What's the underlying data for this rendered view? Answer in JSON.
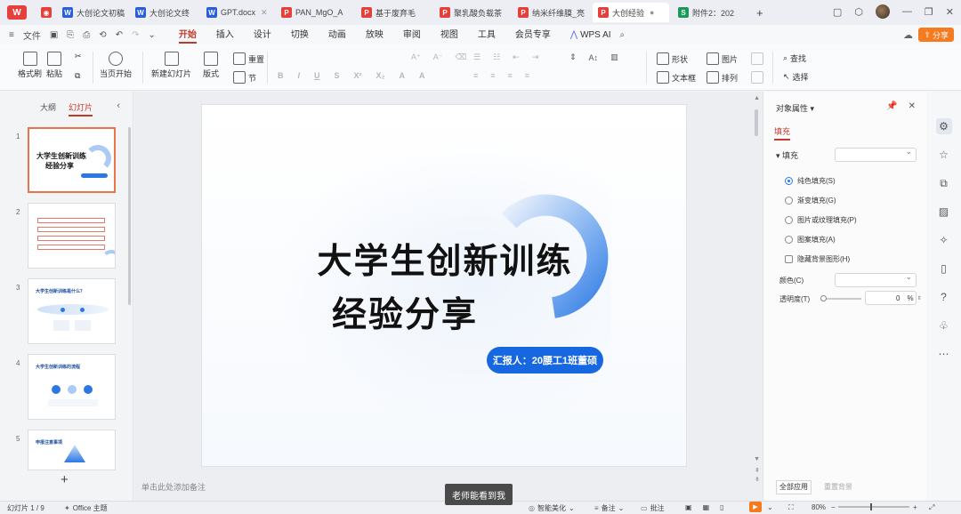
{
  "tabs": [
    {
      "label": "大创论文初稿",
      "icon": "W",
      "color": "#2b5fd9"
    },
    {
      "label": "大创论文终",
      "icon": "W",
      "color": "#2b5fd9"
    },
    {
      "label": "GPT.docx",
      "icon": "W",
      "color": "#2b5fd9"
    },
    {
      "label": "PAN_MgO_A",
      "icon": "P",
      "color": "#e5403b"
    },
    {
      "label": "基于废弃毛",
      "icon": "P",
      "color": "#e5403b"
    },
    {
      "label": "聚乳酸负载茶",
      "icon": "P",
      "color": "#e5403b"
    },
    {
      "label": "纳米纤维膜_亮",
      "icon": "P",
      "color": "#e5403b"
    },
    {
      "label": "大创经验",
      "icon": "P",
      "color": "#e5403b",
      "active": true
    },
    {
      "label": "附件2：202",
      "icon": "S",
      "color": "#1a9a5a"
    }
  ],
  "menubar": {
    "file": "文件",
    "items": [
      "开始",
      "插入",
      "设计",
      "切换",
      "动画",
      "放映",
      "审阅",
      "视图",
      "工具",
      "会员专享"
    ],
    "active": "开始",
    "wps_ai": "WPS AI",
    "share": "分享"
  },
  "ribbon": {
    "format_painter": "格式刷",
    "paste": "粘贴",
    "from_start": "当页开始",
    "new_slide": "新建幻灯片",
    "layout": "版式",
    "reset": "重置",
    "section": "节",
    "shape": "形状",
    "picture": "图片",
    "find": "查找",
    "textbox": "文本框",
    "arrange": "排列",
    "select": "选择"
  },
  "left_panel": {
    "tab_outline": "大纲",
    "tab_slides": "幻灯片",
    "slides": [
      {
        "num": "1",
        "title": "大学生创新训练\n经验分享"
      },
      {
        "num": "2",
        "title": ""
      },
      {
        "num": "3",
        "title": "大学生创新训练是什么？"
      },
      {
        "num": "4",
        "title": "大学生创新训练的流程"
      },
      {
        "num": "5",
        "title": "申报注意事项"
      }
    ]
  },
  "slide": {
    "title_line1": "大学生创新训练",
    "title_line2": "经验分享",
    "reporter": "汇报人：20腰工1班董硕"
  },
  "notes_placeholder": "单击此处添加备注",
  "right_panel": {
    "title": "对象属性",
    "tab": "填充",
    "section": "填充",
    "options": [
      {
        "label": "纯色填充(S)",
        "checked": true
      },
      {
        "label": "渐变填充(G)",
        "checked": false
      },
      {
        "label": "图片或纹理填充(P)",
        "checked": false
      },
      {
        "label": "图案填充(A)",
        "checked": false
      }
    ],
    "hide_bg": "隐藏背景图形(H)",
    "color_label": "颜色(C)",
    "transparency_label": "透明度(T)",
    "transparency_value": "0",
    "transparency_unit": "%",
    "apply_all": "全部应用",
    "reset_bg": "重置背景"
  },
  "statusbar": {
    "slide_info": "幻灯片 1 / 9",
    "theme": "Office 主题",
    "smart_beautify": "智能美化",
    "notes": "备注",
    "comments": "批注",
    "zoom": "80%"
  },
  "subtitle": "老师能看到我"
}
